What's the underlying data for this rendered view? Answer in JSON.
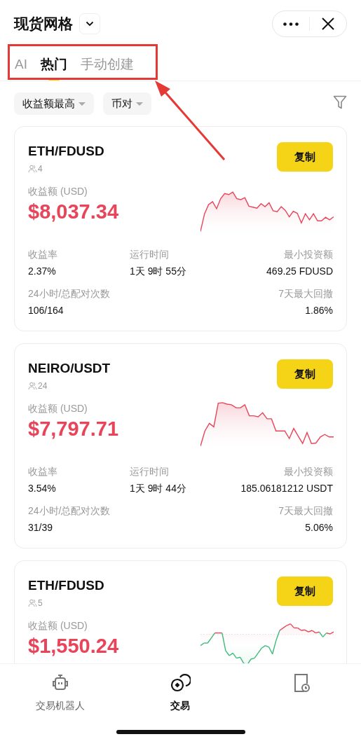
{
  "header": {
    "title": "现货网格"
  },
  "tabs": [
    {
      "label": "AI",
      "selected": false
    },
    {
      "label": "热门",
      "selected": true
    },
    {
      "label": "手动创建",
      "selected": false
    }
  ],
  "filters": [
    {
      "label": "收益额最高"
    },
    {
      "label": "币对"
    }
  ],
  "cards": [
    {
      "pair": "ETH/FDUSD",
      "followers": "4",
      "copy_label": "复制",
      "profit_label": "收益额 (USD)",
      "profit": "$8,037.34",
      "kind": "rise",
      "stats": [
        {
          "label": "收益率",
          "value": "2.37%"
        },
        {
          "label": "运行时间",
          "value": "1天 9时 55分"
        },
        {
          "label": "最小投资额",
          "value": "469.25 FDUSD"
        },
        {
          "label": "24小时/总配对次数",
          "value": "106/164"
        },
        {
          "label": "7天最大回撤",
          "value": "1.86%"
        }
      ]
    },
    {
      "pair": "NEIRO/USDT",
      "followers": "24",
      "copy_label": "复制",
      "profit_label": "收益额 (USD)",
      "profit": "$7,797.71",
      "kind": "peak",
      "stats": [
        {
          "label": "收益率",
          "value": "3.54%"
        },
        {
          "label": "运行时间",
          "value": "1天 9时 44分"
        },
        {
          "label": "最小投资额",
          "value": "185.06181212 USDT"
        },
        {
          "label": "24小时/总配对次数",
          "value": "31/39"
        },
        {
          "label": "7天最大回撤",
          "value": "5.06%"
        }
      ]
    },
    {
      "pair": "ETH/FDUSD",
      "followers": "5",
      "copy_label": "复制",
      "profit_label": "收益额 (USD)",
      "profit": "$1,550.24",
      "kind": "dip"
    }
  ],
  "bottom_nav": [
    {
      "label": "交易机器人",
      "kind": "robot",
      "selected": false
    },
    {
      "label": "交易",
      "kind": "coins",
      "selected": true
    },
    {
      "kind": "clipboard",
      "selected": false
    }
  ]
}
